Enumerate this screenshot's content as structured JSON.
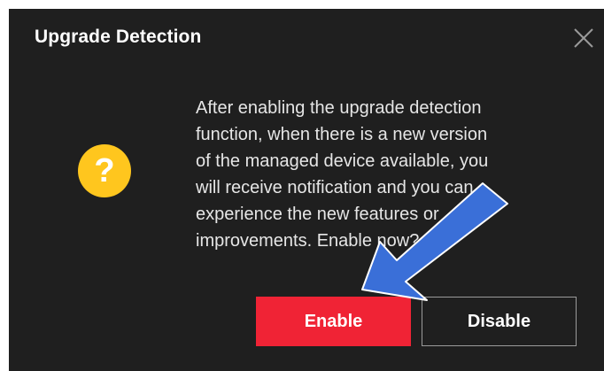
{
  "dialog": {
    "title": "Upgrade Detection",
    "close_icon": "close-icon",
    "question_icon": "question-icon",
    "question_glyph": "?",
    "message_lines": [
      "After enabling the upgrade detection",
      "function, when there is a new version",
      "of the managed device available, you",
      "will receive notification and you can",
      "experience the new features or",
      "improvements. Enable now?"
    ],
    "buttons": {
      "enable_label": "Enable",
      "disable_label": "Disable"
    },
    "colors": {
      "background": "#1f1f1f",
      "enable_button": "#f02335",
      "question_icon": "#ffc61e",
      "annotation_arrow": "#3a6fd8"
    }
  }
}
